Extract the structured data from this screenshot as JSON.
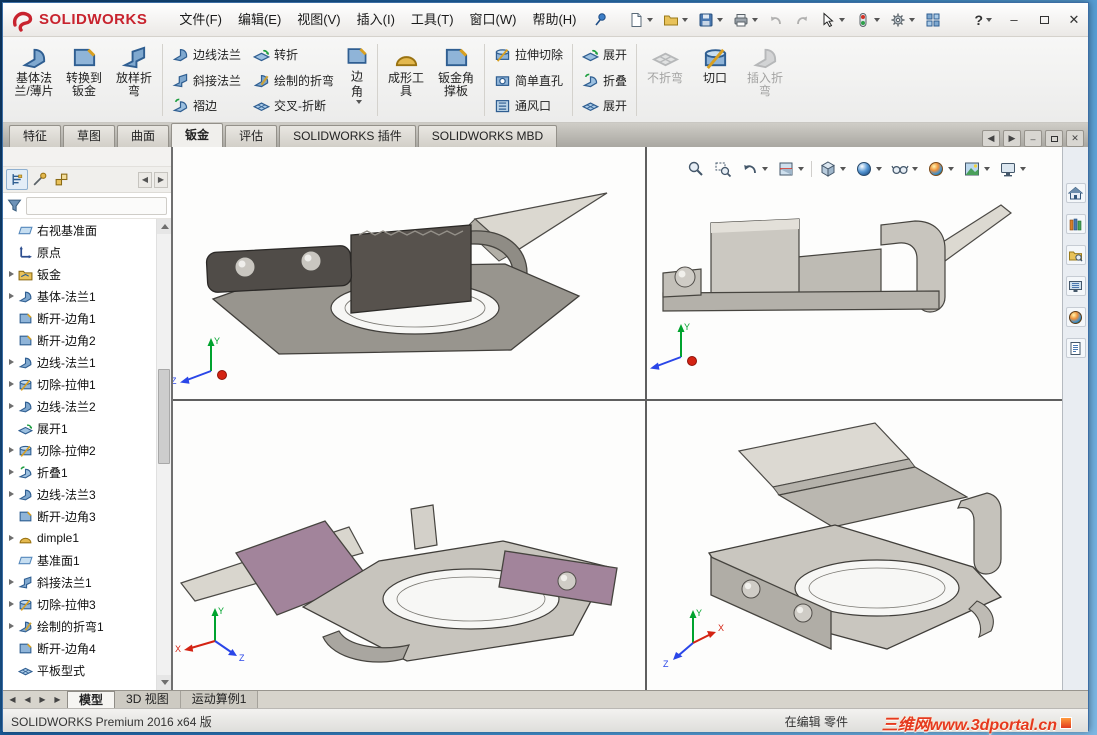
{
  "titlebar": {
    "brand": "SOLIDWORKS",
    "menus": [
      "文件(F)",
      "编辑(E)",
      "视图(V)",
      "插入(I)",
      "工具(T)",
      "窗口(W)",
      "帮助(H)"
    ],
    "controls": {
      "help": "?",
      "minimize": "–",
      "close": "✕"
    }
  },
  "ribbon": {
    "base_flange": "基体法\n兰/薄片",
    "convert_to_sheet_metal": "转换到\n钣金",
    "lofted_bend": "放样折\n弯",
    "edge_flange": "边线法兰",
    "miter_flange": "斜接法兰",
    "hem": "褶边",
    "jog": "转折",
    "sketched_bend": "绘制的折弯",
    "cross_break": "交叉-折断",
    "corner": "边角",
    "forming_tool": "成形工\n具",
    "gusset": "钣金角\n撑板",
    "extruded_cut": "拉伸切除",
    "simple_hole": "简单直孔",
    "vent": "通风口",
    "unfold": "展开",
    "fold": "折叠",
    "flatten": "展开",
    "no_bends": "不折弯",
    "rip": "切口",
    "insert_bends": "插入折\n弯"
  },
  "command_tabs": {
    "items": [
      "特征",
      "草图",
      "曲面",
      "钣金",
      "评估",
      "SOLIDWORKS 插件",
      "SOLIDWORKS MBD"
    ],
    "active": "钣金"
  },
  "feature_tree": {
    "items": [
      {
        "label": "右视基准面",
        "icon": "plane-icon",
        "expandable": false
      },
      {
        "label": "原点",
        "icon": "origin-icon",
        "expandable": false
      },
      {
        "label": "钣金",
        "icon": "sheet-metal-folder-icon",
        "expandable": true
      },
      {
        "label": "基体-法兰1",
        "icon": "base-flange-icon",
        "expandable": true
      },
      {
        "label": "断开-边角1",
        "icon": "break-corner-icon",
        "expandable": false
      },
      {
        "label": "断开-边角2",
        "icon": "break-corner-icon",
        "expandable": false
      },
      {
        "label": "边线-法兰1",
        "icon": "edge-flange-icon",
        "expandable": true
      },
      {
        "label": "切除-拉伸1",
        "icon": "cut-extrude-icon",
        "expandable": true
      },
      {
        "label": "边线-法兰2",
        "icon": "edge-flange-icon",
        "expandable": true
      },
      {
        "label": "展开1",
        "icon": "unfold-icon",
        "expandable": false
      },
      {
        "label": "切除-拉伸2",
        "icon": "cut-extrude-icon",
        "expandable": true
      },
      {
        "label": "折叠1",
        "icon": "fold-icon",
        "expandable": true
      },
      {
        "label": "边线-法兰3",
        "icon": "edge-flange-icon",
        "expandable": true
      },
      {
        "label": "断开-边角3",
        "icon": "break-corner-icon",
        "expandable": false
      },
      {
        "label": "dimple1",
        "icon": "dimple-icon",
        "expandable": true
      },
      {
        "label": "基准面1",
        "icon": "plane-icon",
        "expandable": false
      },
      {
        "label": "斜接法兰1",
        "icon": "miter-flange-icon",
        "expandable": true
      },
      {
        "label": "切除-拉伸3",
        "icon": "cut-extrude-icon",
        "expandable": true
      },
      {
        "label": "绘制的折弯1",
        "icon": "sketched-bend-icon",
        "expandable": true
      },
      {
        "label": "断开-边角4",
        "icon": "break-corner-icon",
        "expandable": false
      },
      {
        "label": "平板型式",
        "icon": "flat-pattern-icon",
        "expandable": false
      }
    ]
  },
  "viewport": {
    "triad": {
      "x": "X",
      "y": "Y",
      "z": "Z"
    }
  },
  "document_tabs": {
    "items": [
      "模型",
      "3D 视图",
      "运动算例1"
    ],
    "active": "模型"
  },
  "statusbar": {
    "product": "SOLIDWORKS Premium 2016 x64 版",
    "edit_mode": "在编辑 零件",
    "watermark": "三维网www.3dportal.cn"
  },
  "icons": {
    "left_arrow": "◀",
    "right_arrow": "▶"
  }
}
